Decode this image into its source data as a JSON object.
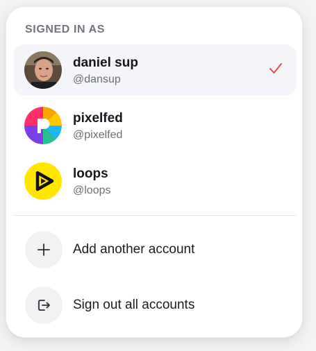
{
  "menu": {
    "section_title": "SIGNED IN AS",
    "accounts": [
      {
        "name": "daniel sup",
        "handle": "@dansup",
        "selected": true,
        "avatar": "photo-avatar"
      },
      {
        "name": "pixelfed",
        "handle": "@pixelfed",
        "selected": false,
        "avatar": "pixelfed-logo"
      },
      {
        "name": "loops",
        "handle": "@loops",
        "selected": false,
        "avatar": "loops-logo"
      }
    ],
    "actions": [
      {
        "label": "Add another account",
        "icon": "plus-icon"
      },
      {
        "label": "Sign out all accounts",
        "icon": "sign-out-icon"
      }
    ]
  },
  "colors": {
    "check": "#e5484d",
    "loops_yellow": "#ffe500",
    "header_text": "#71737e",
    "active_row": "#f4f5f8"
  }
}
